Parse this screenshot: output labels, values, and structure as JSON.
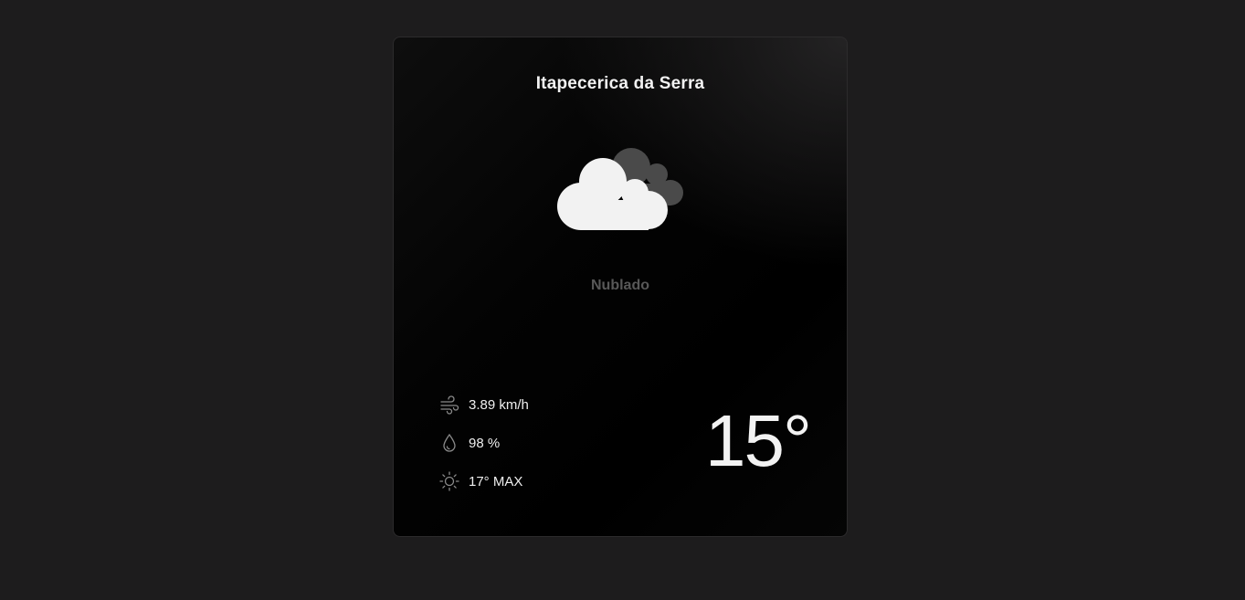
{
  "weather_card": {
    "city": "Itapecerica da Serra",
    "icon": "cloudy-icon",
    "condition": "Nublado",
    "wind": {
      "icon": "wind-icon",
      "value": "3.89 km/h"
    },
    "humidity": {
      "icon": "droplet-icon",
      "value": "98 %"
    },
    "max_temp": {
      "icon": "sun-icon",
      "value": "17° MAX"
    },
    "temperature": "15°"
  },
  "colors": {
    "page_background": "#1d1c1d",
    "card_background": "#000000",
    "primary_text": "#f2f2f2",
    "muted_text": "#585858",
    "cloud_front": "#f2f2f2",
    "cloud_back": "#4a4a4a"
  }
}
